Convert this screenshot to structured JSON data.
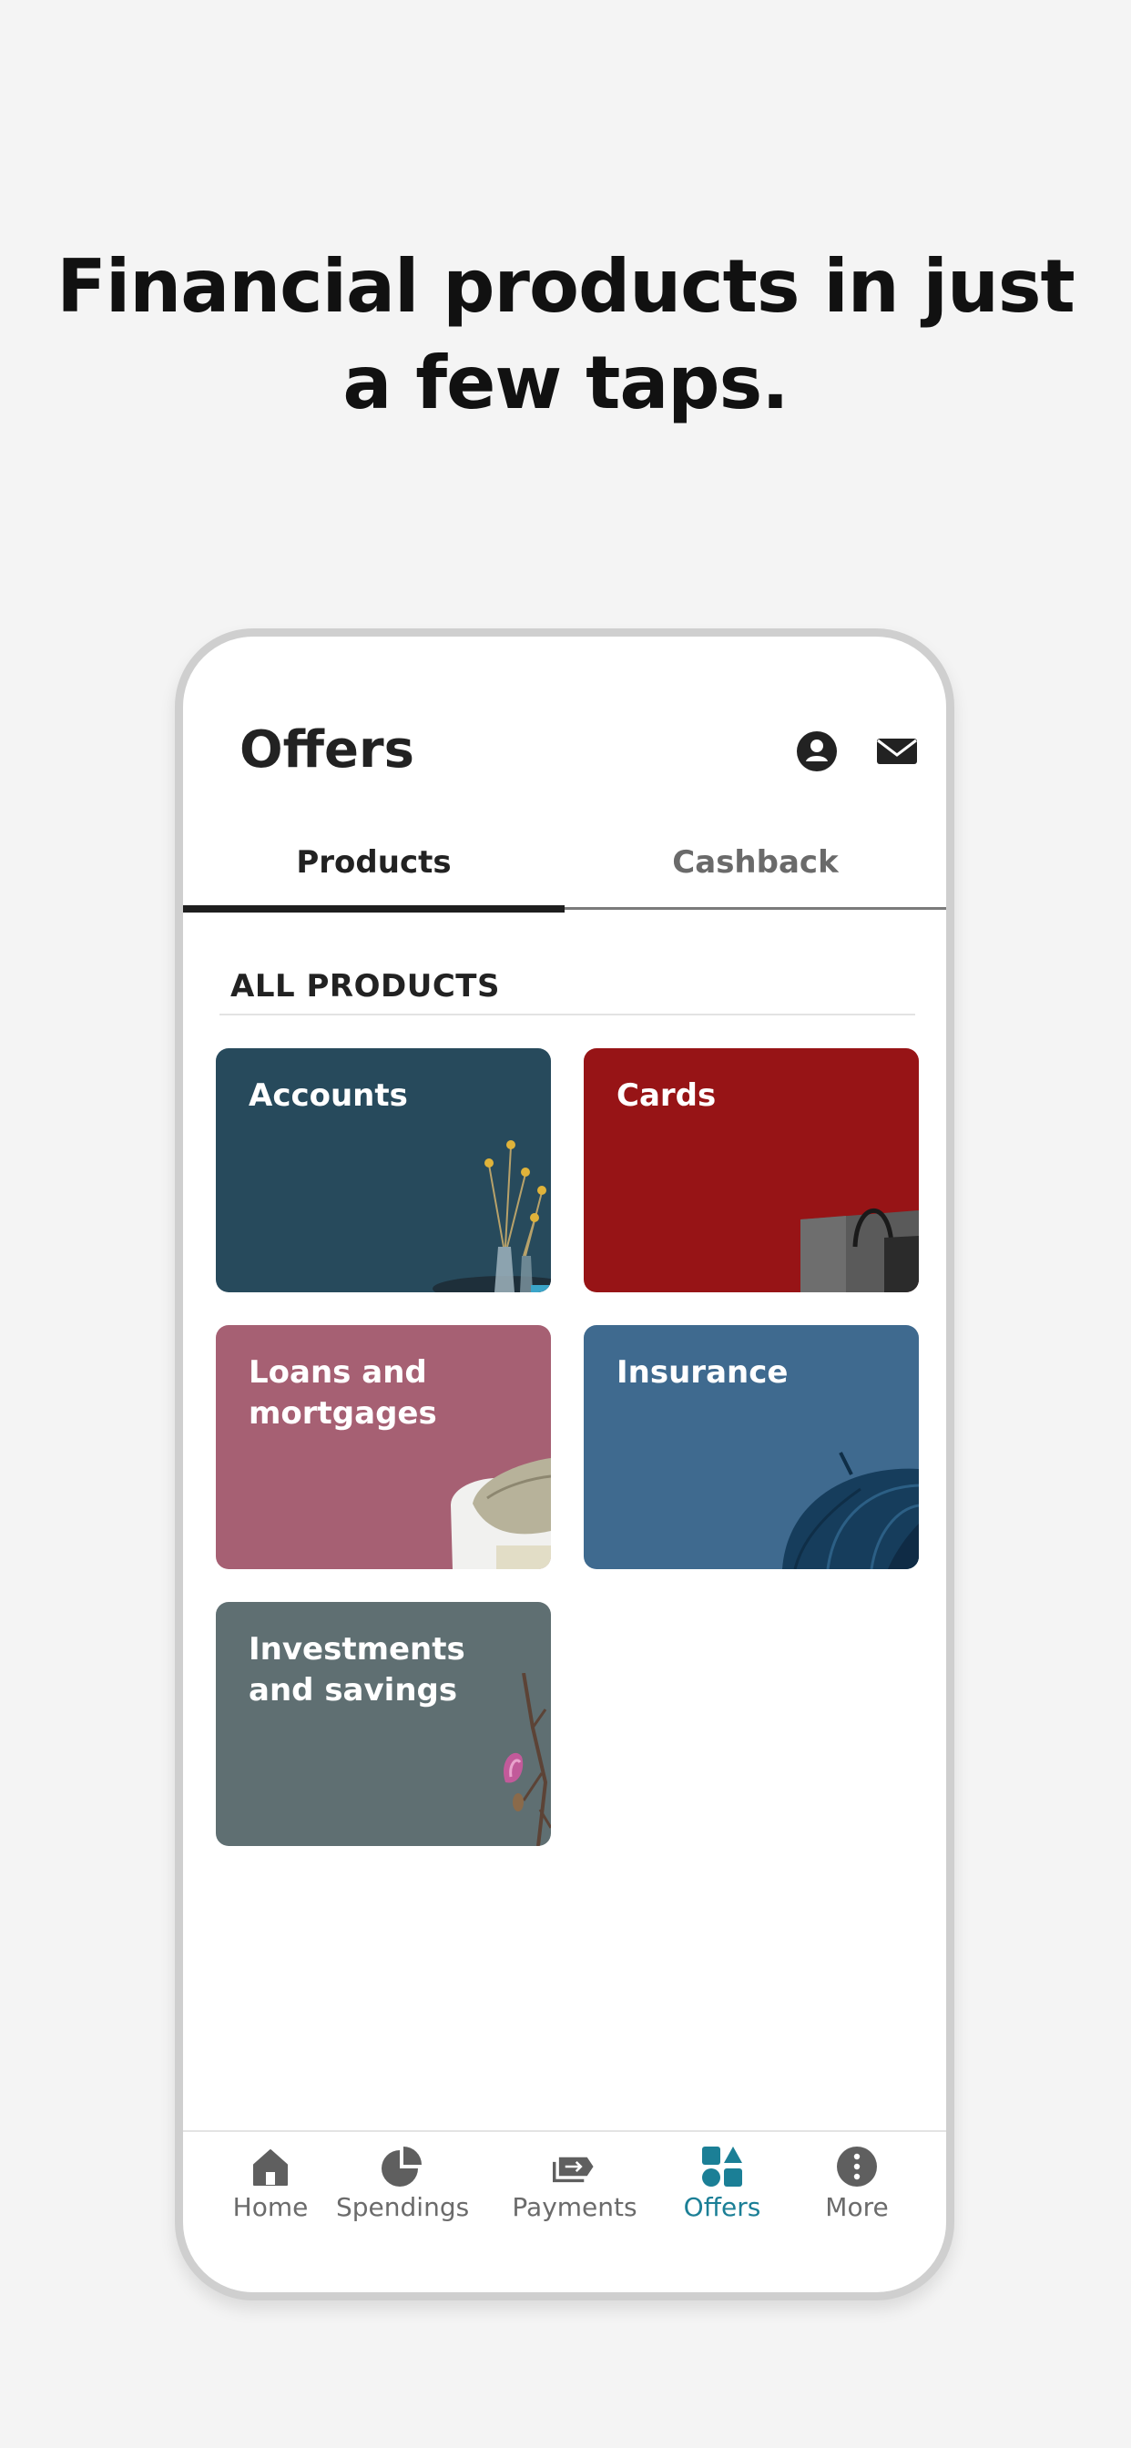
{
  "promo": {
    "headline_line1": "Financial products in just",
    "headline_line2": "a few taps."
  },
  "header": {
    "title": "Offers",
    "icons": [
      "profile-icon",
      "mail-icon"
    ]
  },
  "tabs": [
    {
      "label": "Products",
      "active": true
    },
    {
      "label": "Cashback",
      "active": false
    }
  ],
  "section": {
    "title": "ALL PRODUCTS"
  },
  "products": [
    {
      "label": "Accounts",
      "color": "#274a5c"
    },
    {
      "label": "Cards",
      "color": "#971416"
    },
    {
      "label": "Loans and mortgages",
      "color": "#a66073"
    },
    {
      "label": "Insurance",
      "color": "#3f6a8f"
    },
    {
      "label": "Investments and savings",
      "color": "#5f6f72"
    }
  ],
  "bottom_nav": [
    {
      "label": "Home",
      "icon": "home-icon",
      "active": false
    },
    {
      "label": "Spendings",
      "icon": "pie-chart-icon",
      "active": false
    },
    {
      "label": "Payments",
      "icon": "transfer-icon",
      "active": false
    },
    {
      "label": "Offers",
      "icon": "offers-icon",
      "active": true
    },
    {
      "label": "More",
      "icon": "more-icon",
      "active": false
    }
  ],
  "colors": {
    "accent": "#1b7f96",
    "inactive": "#6b6b6b",
    "background": "#f4f4f4"
  }
}
